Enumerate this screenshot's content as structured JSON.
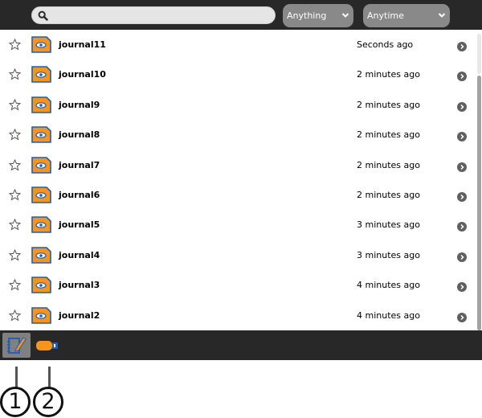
{
  "toolbar": {
    "search": {
      "value": "",
      "placeholder": ""
    },
    "filter_type": {
      "selected": "Anything"
    },
    "filter_time": {
      "selected": "Anytime"
    }
  },
  "entries": [
    {
      "title": "journal11",
      "time": "Seconds ago"
    },
    {
      "title": "journal10",
      "time": "2 minutes ago"
    },
    {
      "title": "journal9",
      "time": "2 minutes ago"
    },
    {
      "title": "journal8",
      "time": "2 minutes ago"
    },
    {
      "title": "journal7",
      "time": "2 minutes ago"
    },
    {
      "title": "journal6",
      "time": "2 minutes ago"
    },
    {
      "title": "journal5",
      "time": "3 minutes ago"
    },
    {
      "title": "journal4",
      "time": "3 minutes ago"
    },
    {
      "title": "journal3",
      "time": "4 minutes ago"
    },
    {
      "title": "journal2",
      "time": "4 minutes ago"
    }
  ],
  "colors": {
    "toolbar_bg": "#282828",
    "journal_icon_fill": "#f7941d",
    "journal_icon_stroke": "#1d5fb4",
    "arrow_circle": "#5f5f5f",
    "dropdown_bg": "#898989"
  },
  "icons": {
    "search": "magnifier-icon",
    "star": "star-outline-icon",
    "entry": "journal-entry-icon",
    "detail": "right-arrow-circle-icon",
    "bottom_journal": "journal-view-icon",
    "bottom_device": "usb-device-icon"
  },
  "callouts": [
    "1",
    "2"
  ]
}
